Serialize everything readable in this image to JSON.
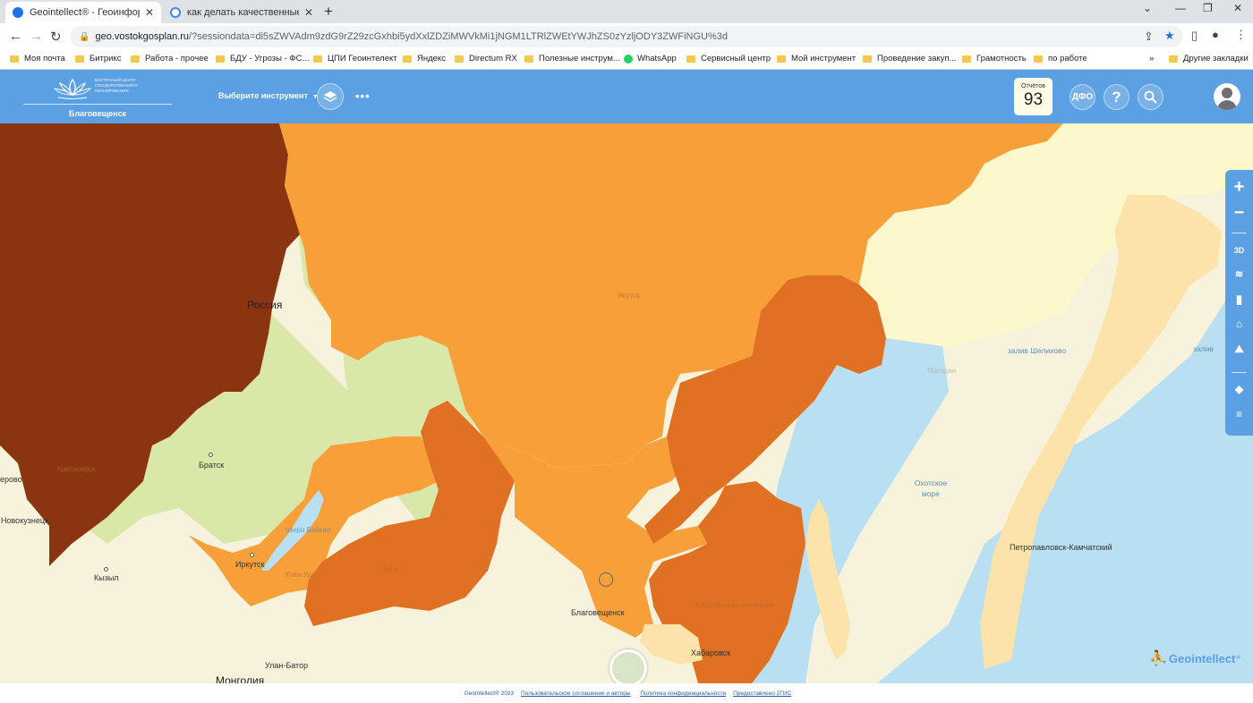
{
  "browser": {
    "tabs": [
      {
        "title": "Geointellect® - Геоинформаци",
        "active": true,
        "favicon_color": "#1a73e8"
      },
      {
        "title": "как делать качественные сним",
        "active": false,
        "favicon_color": "#4285f4"
      }
    ],
    "url_host": "geo.vostokgosplan.ru",
    "url_path": "/?sessiondata=di5sZWVAdm9zdG9rZ29zcGxhbi5ydXxlZDZiMWVkMi1jNGM1LTRlZWEtYWJhZS0zYzljODY3ZWFiNGU%3d",
    "bookmarks": [
      "Моя почта",
      "Битрикс",
      "Работа - прочее",
      "БДУ - Угрозы - ФС...",
      "ЦПИ Геоинтелект",
      "Яндекс",
      "Directum RX",
      "Полезные инструм...",
      "WhatsApp",
      "Сервисный центр",
      "Мой инструмент",
      "Проведение закуп...",
      "Грамотность",
      "по работе"
    ],
    "bookmarks_more": "»",
    "other_bookmarks": "Другие закладки"
  },
  "header": {
    "city": "Благовещенск",
    "org_name": "ВОСТОЧНЫЙ ЦЕНТР ГОСУДАРСТВЕННОГО ПЛАНИРОВАНИЯ",
    "tool_select": "Выберите инструмент",
    "more": "•••",
    "reports_label": "Отчётов",
    "reports_count": "93",
    "region_btn": "ДФО",
    "help_btn": "?"
  },
  "map": {
    "labels": {
      "russia": "Россия",
      "mongolia": "Монголия",
      "bratsk": "Братск",
      "irkutsk": "Иркутск",
      "novokuznetsk": "Новокузнецк",
      "kyzyl": "Кызыл",
      "kemerovo": "ерово",
      "ulanbator": "Улан-Батор",
      "blagoveshchensk": "Благовещенск",
      "khabarovsk": "Хабаровск",
      "petropavlovsk": "Петропавловск-Камчатский",
      "okhotsk_sea": "Охотское море",
      "shelikhov": "залив Шелихово",
      "zaliv": "залив",
      "krasnoyarsk": "Красноярск",
      "yakutsk": "Якутск",
      "magadan": "Магадан",
      "ulan_ude": "Улан-Удэ",
      "chita": "Чита",
      "ozero_baikal": "озеро Байкал",
      "komsomolsk": "Комсомольск-на-Амуре"
    },
    "colors": {
      "dark": "#8b3510",
      "orange": "#f7a03a",
      "mid": "#e07022",
      "light": "#fce3a9",
      "pale": "#fdf8cb",
      "green": "#d9e8a8",
      "land": "#f7f2dc",
      "water": "#b9dff2"
    }
  },
  "sidebar": {
    "zoom_in": "+",
    "zoom_out": "−",
    "mode_3d": "3D"
  },
  "brand": "Geointellect",
  "footer": {
    "copyright": "Geointellect® 2023",
    "terms": "Пользовательское соглашение и авторы",
    "privacy": "Политика конфиденциальности",
    "provider": "Предоставлено 2ГИС"
  }
}
